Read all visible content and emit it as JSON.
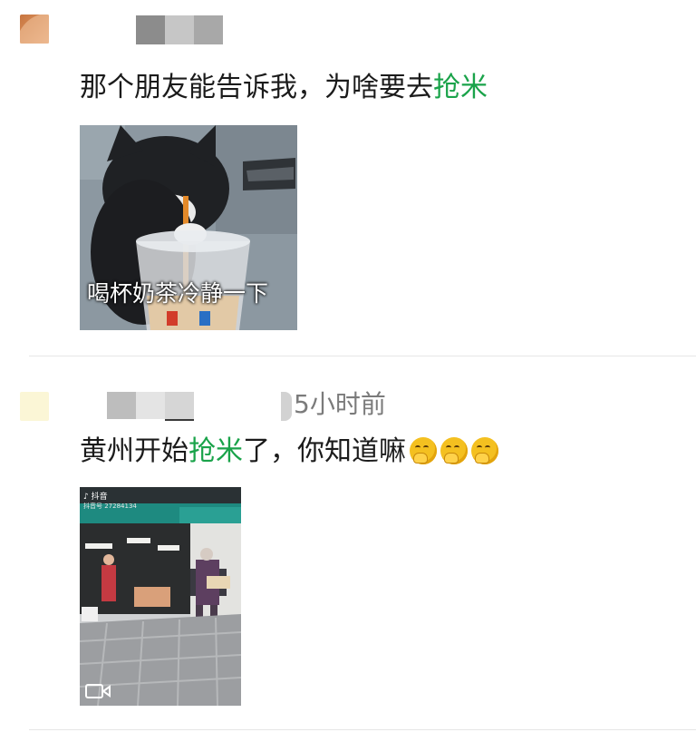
{
  "posts": [
    {
      "message_prefix": "那个朋友能告诉我，为啥要去",
      "message_highlight": "抢米",
      "image_caption": "喝杯奶茶冷静一下",
      "avatar_color": "#d89060"
    },
    {
      "timestamp": "5小时前",
      "message_prefix": "黄州开始",
      "message_highlight": "抢米",
      "message_suffix": "了，你知道嘛",
      "emoji": [
        "thinking-face-icon",
        "thinking-face-icon",
        "thinking-face-icon"
      ],
      "avatar_color": "#fbf6d6",
      "video_overlay": {
        "app_label": "抖音",
        "user_id": "抖音号 27284134"
      }
    }
  ],
  "colors": {
    "highlight": "#1aa34a",
    "divider": "#e6e6e6",
    "timestamp": "#7b7b7b"
  }
}
